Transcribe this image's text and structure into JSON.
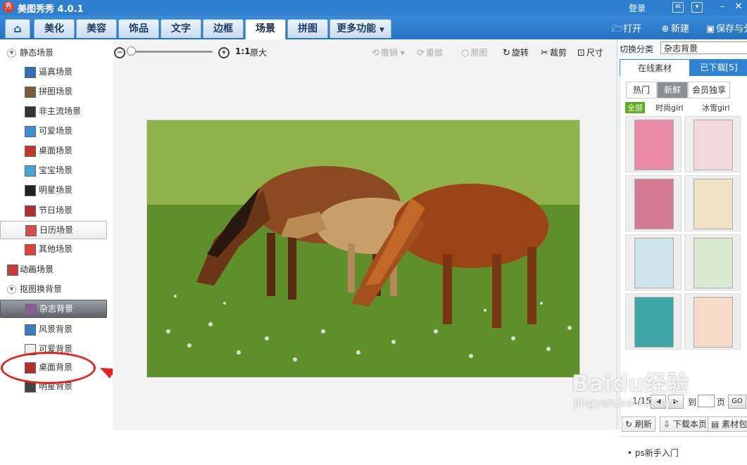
{
  "app": {
    "title": "美图秀秀 4.0.1",
    "logo_text": "秀"
  },
  "titlebar": {
    "login": "登录"
  },
  "tabs": [
    {
      "label": "美化"
    },
    {
      "label": "美容"
    },
    {
      "label": "饰品"
    },
    {
      "label": "文字"
    },
    {
      "label": "边框"
    },
    {
      "label": "场景",
      "active": true
    },
    {
      "label": "拼图"
    },
    {
      "label": "更多功能"
    }
  ],
  "top_actions": {
    "open": "打开",
    "new": "新建",
    "save": "保存与分享"
  },
  "left_panel": {
    "groups": [
      {
        "label": "静态场景"
      },
      {
        "label": "动画场景"
      },
      {
        "label": "抠图换背景"
      }
    ],
    "static_items": [
      {
        "label": "逼真场景",
        "thumb_color": "#2f6fb6"
      },
      {
        "label": "拼图场景",
        "thumb_color": "#7a5c3a"
      },
      {
        "label": "非主流场景",
        "thumb_color": "#333333"
      },
      {
        "label": "可爱场景",
        "thumb_color": "#3b8fd6"
      },
      {
        "label": "桌面场景",
        "thumb_color": "#c0392b"
      },
      {
        "label": "宝宝场景",
        "thumb_color": "#4aa3d8"
      },
      {
        "label": "明星场景",
        "thumb_color": "#222222"
      },
      {
        "label": "节日场景",
        "thumb_color": "#b03030"
      },
      {
        "label": "日历场景",
        "thumb_color": "#d84b4b"
      },
      {
        "label": "其他场景",
        "thumb_color": "#e04040"
      }
    ],
    "bg_items": [
      {
        "label": "杂志背景",
        "thumb_color": "#8a5c9a"
      },
      {
        "label": "风景背景",
        "thumb_color": "#3a7cc4"
      },
      {
        "label": "可爱背景",
        "thumb_color": "#f0f0f0"
      },
      {
        "label": "桌面背景",
        "thumb_color": "#b03030"
      },
      {
        "label": "明星背景",
        "thumb_color": "#444444"
      }
    ]
  },
  "toolbar": {
    "zoom_ratio": "1:1",
    "original_size": "原大",
    "undo": "撤销",
    "redo": "重做",
    "original": "原图",
    "rotate": "旋转",
    "crop": "裁剪",
    "size": "尺寸"
  },
  "right_panel": {
    "switch_label": "切换分类",
    "category": "杂志背景",
    "tab_online": "在线素材",
    "tab_downloaded": "已下载[5]",
    "subtabs": [
      "热门",
      "新鲜",
      "会员独享"
    ],
    "filters": [
      "全部",
      "时尚girl",
      "冰雪girl"
    ],
    "posters": [
      {
        "color": "#e98aa6"
      },
      {
        "color": "#f3d9dc"
      },
      {
        "color": "#d47a93"
      },
      {
        "color": "#efe2c5"
      },
      {
        "color": "#cfe4ea"
      },
      {
        "color": "#d9ead1"
      },
      {
        "color": "#3fa7a8"
      },
      {
        "color": "#f6dcc8"
      }
    ],
    "pager_text": "1/15",
    "pager_goto": "到",
    "pager_page": "页",
    "pager_go": "GO",
    "btn_refresh": "刷新",
    "btn_download_page": "下载本页",
    "btn_pack": "素材包",
    "list_item": "ps新手入门"
  },
  "watermark": {
    "main": "Baidu经验",
    "sub": "jingyan.baidu.com"
  }
}
